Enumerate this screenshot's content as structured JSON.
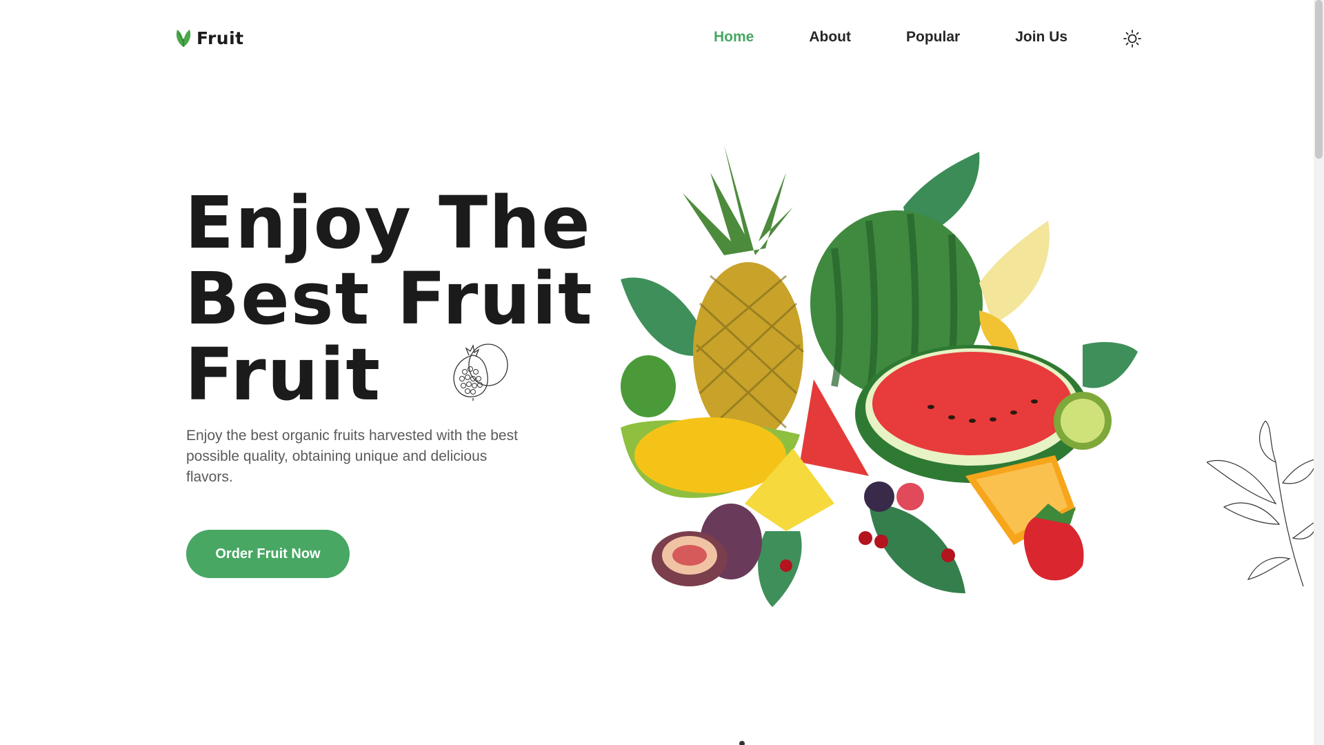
{
  "logo": {
    "text": "Fruit",
    "icon": "leaf-icon",
    "color": "#47a763"
  },
  "nav": {
    "items": [
      {
        "label": "Home",
        "active": true
      },
      {
        "label": "About",
        "active": false
      },
      {
        "label": "Popular",
        "active": false
      },
      {
        "label": "Join Us",
        "active": false
      }
    ],
    "theme_icon": "sun-icon"
  },
  "hero": {
    "title_lines": [
      "Enjoy The",
      "Best Fruit",
      "Fruit"
    ],
    "description": "Enjoy the best organic fruits harvested with the best possible quality, obtaining unique and delicious flavors.",
    "cta_label": "Order Fruit Now"
  },
  "colors": {
    "accent": "#47a763",
    "text": "#1b1b1b",
    "muted": "#5a5a5a"
  }
}
